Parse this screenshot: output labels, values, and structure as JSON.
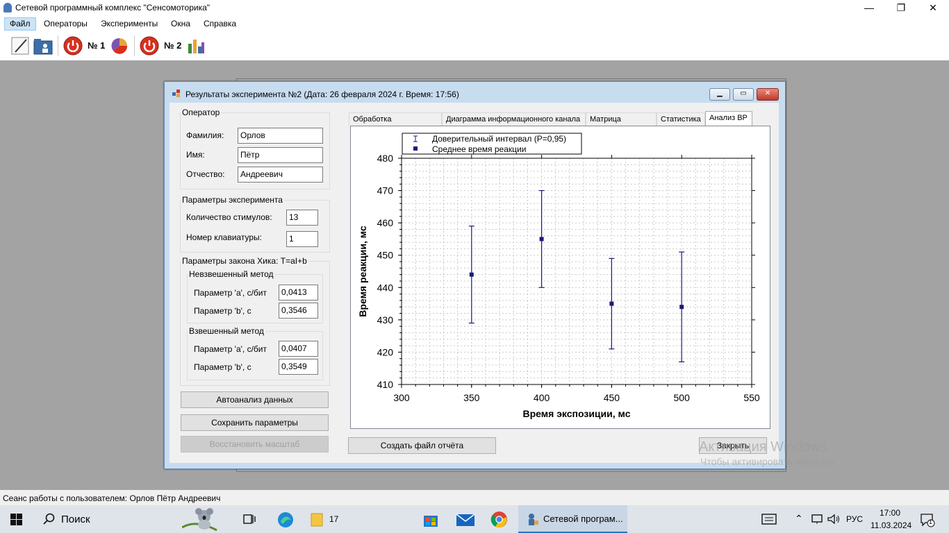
{
  "app": {
    "title": "Сетевой программный комплекс \"Сенсомоторика\"",
    "minimize": "—",
    "restore": "❐",
    "close": "✕"
  },
  "menu": {
    "items": [
      "Файл",
      "Операторы",
      "Эксперименты",
      "Окна",
      "Справка"
    ]
  },
  "toolbar": {
    "label1": "№ 1",
    "label2": "№ 2"
  },
  "dialog": {
    "title": "Результаты эксперимента №2 (Дата: 26 февраля 2024 г. Время: 17:56)",
    "operator": {
      "legend": "Оператор",
      "surname_label": "Фамилия:",
      "surname": "Орлов",
      "name_label": "Имя:",
      "name": "Пётр",
      "patronymic_label": "Отчество:",
      "patronymic": "Андреевич"
    },
    "params": {
      "legend": "Параметры эксперимента",
      "stimuli_label": "Количество стимулов:",
      "stimuli": "13",
      "keyboard_label": "Номер клавиатуры:",
      "keyboard": "1"
    },
    "hick": {
      "legend": "Параметры закона Хика: T=aI+b",
      "unweighted": {
        "legend": "Невзвешенный метод",
        "a_label": "Параметр 'a', с/бит",
        "a": "0,0413",
        "b_label": "Параметр 'b', с",
        "b": "0,3546"
      },
      "weighted": {
        "legend": "Взвешенный метод",
        "a_label": "Параметр 'a', с/бит",
        "a": "0,0407",
        "b_label": "Параметр 'b', с",
        "b": "0,3549"
      }
    },
    "buttons": {
      "autoanalysis": "Автоанализ данных",
      "save_params": "Сохранить параметры",
      "restore_scale": "Восстановить масштаб",
      "create_report": "Создать файл отчёта",
      "close": "Закрыть"
    },
    "tabs": [
      "Обработка информации",
      "Диаграмма информационного канала",
      "Матрица замеров",
      "Статистика",
      "Анализ ВР"
    ],
    "selected_tab": "Анализ ВР"
  },
  "chart_data": {
    "type": "scatter",
    "xlabel": "Время экспозиции, мс",
    "ylabel": "Время реакции, мс",
    "xlim": [
      300,
      550
    ],
    "ylim": [
      410,
      480
    ],
    "xticks": [
      300,
      350,
      400,
      450,
      500,
      550
    ],
    "yticks": [
      410,
      420,
      430,
      440,
      450,
      460,
      470,
      480
    ],
    "grid": true,
    "legend_position": "top-left",
    "legend": [
      "Доверительный интервал (P=0,95)",
      "Среднее время реакции"
    ],
    "series": [
      {
        "name": "Среднее время реакции",
        "points": [
          {
            "x": 350,
            "y": 444,
            "low": 429,
            "high": 459
          },
          {
            "x": 400,
            "y": 455,
            "low": 440,
            "high": 470
          },
          {
            "x": 450,
            "y": 435,
            "low": 421,
            "high": 449
          },
          {
            "x": 500,
            "y": 434,
            "low": 417,
            "high": 451
          }
        ]
      }
    ],
    "color": "#1a1a7a"
  },
  "status": {
    "text": "Сеанс работы с пользователем: Орлов Пётр Андреевич"
  },
  "taskbar": {
    "search": "Поиск",
    "folder_count": "17",
    "active_app": "Сетевой програм...",
    "lang": "РУС",
    "time": "17:00",
    "date": "11.03.2024",
    "notif": "1"
  },
  "watermark": {
    "line1": "Активация Windows",
    "line2": "Чтобы активировать Windows"
  }
}
